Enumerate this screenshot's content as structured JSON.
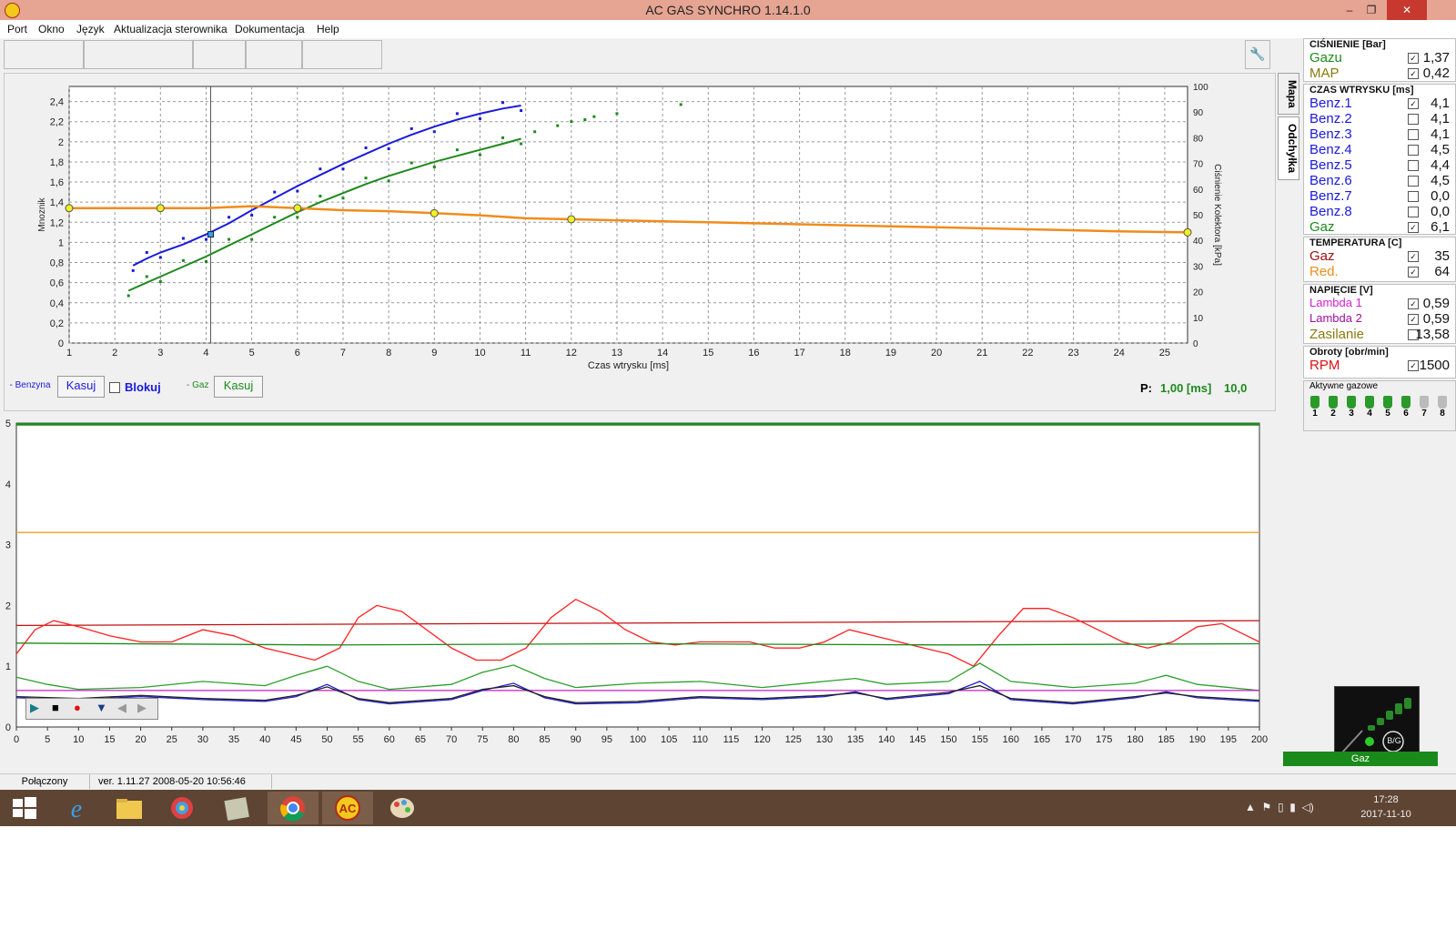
{
  "window": {
    "title": "AC GAS SYNCHRO     1.14.1.0",
    "minimize": "–",
    "restore": "❐",
    "close": "✕"
  },
  "menu": [
    "Port",
    "Okno",
    "Język",
    "Aktualizacja sterownika",
    "Dokumentacja",
    "Help"
  ],
  "side_tabs": {
    "map": "Mapa",
    "deviation": "Odchyłka"
  },
  "map_chart": {
    "y_left_label": "Mnoznik",
    "y_right_label": "Ciśnienie Kolektora [kPa]",
    "x_label": "Czas wtrysku [ms]",
    "y_left_ticks": [
      "0",
      "0,2",
      "0,4",
      "0,6",
      "0,8",
      "1",
      "1,2",
      "1,4",
      "1,6",
      "1,8",
      "2",
      "2,2",
      "2,4"
    ],
    "y_right_ticks": [
      "0",
      "10",
      "20",
      "30",
      "40",
      "50",
      "60",
      "70",
      "80",
      "90",
      "100"
    ],
    "x_ticks": [
      "1",
      "2",
      "3",
      "4",
      "5",
      "6",
      "7",
      "8",
      "9",
      "10",
      "11",
      "12",
      "13",
      "14",
      "15",
      "16",
      "17",
      "18",
      "19",
      "20",
      "21",
      "22",
      "23",
      "24",
      "25"
    ]
  },
  "map_controls": {
    "benzyna_legend": "- Benzyna",
    "kasuj_left": "Kasuj",
    "blokuj": "Blokuj",
    "gaz_legend": "- Gaz",
    "kasuj_right": "Kasuj",
    "p_label": "P:",
    "p_value": "1,00 [ms]",
    "p_value2": "10,0"
  },
  "chart_data": [
    {
      "type": "scatter",
      "title": "",
      "xlabel": "Czas wtrysku [ms]",
      "ylabel": "Mnoznik",
      "xlim": [
        1,
        25.5
      ],
      "ylim": [
        0,
        2.55
      ],
      "series": [
        {
          "name": "Benzyna",
          "color": "#1a1adc",
          "x": [
            2.4,
            2.7,
            3.0,
            3.5,
            4.0,
            4.5,
            5.0,
            5.5,
            6.0,
            6.5,
            7.0,
            7.5,
            8.0,
            8.5,
            9.0,
            9.5,
            10.0,
            10.5,
            10.9
          ],
          "values": [
            0.77,
            0.84,
            0.9,
            0.98,
            1.08,
            1.19,
            1.32,
            1.44,
            1.56,
            1.67,
            1.78,
            1.88,
            1.98,
            2.07,
            2.15,
            2.22,
            2.28,
            2.33,
            2.36
          ]
        },
        {
          "name": "Gaz",
          "color": "#1d8a1d",
          "x": [
            2.3,
            2.7,
            3.0,
            3.5,
            4.0,
            4.5,
            5.0,
            5.5,
            6.0,
            6.5,
            7.0,
            7.5,
            8.0,
            8.5,
            9.0,
            9.5,
            10.0,
            10.5,
            10.9
          ],
          "values": [
            0.52,
            0.6,
            0.66,
            0.76,
            0.86,
            0.97,
            1.08,
            1.19,
            1.3,
            1.4,
            1.49,
            1.58,
            1.66,
            1.73,
            1.8,
            1.86,
            1.92,
            1.98,
            2.03
          ]
        },
        {
          "name": "Ciśnienie",
          "color": "#f08c1c",
          "x": [
            1,
            2,
            3,
            4,
            5,
            6,
            7,
            8,
            9,
            10,
            11,
            12,
            13,
            14,
            15,
            16,
            17,
            18,
            19,
            20,
            21,
            22,
            23,
            24,
            25.5
          ],
          "values": [
            1.34,
            1.34,
            1.34,
            1.34,
            1.36,
            1.34,
            1.32,
            1.31,
            1.29,
            1.27,
            1.24,
            1.23,
            1.22,
            1.21,
            1.2,
            1.19,
            1.18,
            1.17,
            1.16,
            1.15,
            1.14,
            1.13,
            1.12,
            1.11,
            1.1
          ]
        },
        {
          "name": "Gaz points",
          "color": "#1d8a1d",
          "x": [
            11.2,
            11.7,
            12.0,
            12.3,
            12.5,
            13.0,
            14.4
          ],
          "values": [
            2.1,
            2.16,
            2.2,
            2.22,
            2.25,
            2.28,
            2.37
          ]
        }
      ]
    },
    {
      "type": "line",
      "title": "",
      "xlim": [
        0,
        200
      ],
      "ylim": [
        0,
        5
      ],
      "x_ticks": [
        "0",
        "5",
        "10",
        "15",
        "20",
        "25",
        "30",
        "35",
        "40",
        "45",
        "50",
        "55",
        "60",
        "65",
        "70",
        "75",
        "80",
        "85",
        "90",
        "95",
        "100",
        "105",
        "110",
        "115",
        "120",
        "125",
        "130",
        "135",
        "140",
        "145",
        "150",
        "155",
        "160",
        "165",
        "170",
        "175",
        "180",
        "185",
        "190",
        "195",
        "200"
      ],
      "y_ticks": [
        "0",
        "1",
        "2",
        "3",
        "4",
        "5"
      ],
      "series": [
        {
          "name": "green-top",
          "color": "#1d8a1d",
          "x": [
            0,
            200
          ],
          "values": [
            4.98,
            4.98
          ]
        },
        {
          "name": "orange",
          "color": "#f0a020",
          "x": [
            0,
            200
          ],
          "values": [
            3.2,
            3.2
          ]
        },
        {
          "name": "red-mean",
          "color": "#c01010",
          "x": [
            0,
            200
          ],
          "values": [
            1.67,
            1.75
          ]
        },
        {
          "name": "red",
          "color": "#ff2020",
          "x": [
            0,
            3,
            6,
            10,
            15,
            20,
            25,
            30,
            35,
            40,
            44,
            48,
            52,
            55,
            58,
            62,
            66,
            70,
            74,
            78,
            82,
            86,
            90,
            94,
            98,
            102,
            106,
            110,
            114,
            118,
            122,
            126,
            130,
            134,
            138,
            142,
            146,
            150,
            154,
            158,
            162,
            166,
            170,
            174,
            178,
            182,
            186,
            190,
            194,
            198,
            200
          ],
          "values": [
            1.2,
            1.6,
            1.75,
            1.65,
            1.5,
            1.4,
            1.4,
            1.6,
            1.5,
            1.3,
            1.2,
            1.1,
            1.3,
            1.8,
            2.0,
            1.9,
            1.6,
            1.3,
            1.1,
            1.1,
            1.3,
            1.8,
            2.1,
            1.9,
            1.6,
            1.4,
            1.35,
            1.4,
            1.4,
            1.4,
            1.3,
            1.3,
            1.4,
            1.6,
            1.5,
            1.4,
            1.3,
            1.2,
            1.0,
            1.5,
            1.95,
            1.95,
            1.8,
            1.6,
            1.4,
            1.3,
            1.4,
            1.65,
            1.7,
            1.5,
            1.4
          ]
        },
        {
          "name": "green-mean",
          "color": "#1d8a1d",
          "x": [
            0,
            50,
            100,
            150,
            200
          ],
          "values": [
            1.38,
            1.35,
            1.37,
            1.35,
            1.37
          ]
        },
        {
          "name": "green",
          "color": "#2aa02a",
          "x": [
            0,
            5,
            10,
            20,
            30,
            40,
            45,
            50,
            55,
            60,
            70,
            75,
            80,
            85,
            90,
            100,
            110,
            120,
            130,
            135,
            140,
            150,
            155,
            160,
            170,
            180,
            185,
            190,
            200
          ],
          "values": [
            0.82,
            0.7,
            0.62,
            0.65,
            0.75,
            0.68,
            0.85,
            1.0,
            0.75,
            0.62,
            0.7,
            0.9,
            1.02,
            0.8,
            0.65,
            0.72,
            0.75,
            0.65,
            0.75,
            0.8,
            0.7,
            0.75,
            1.05,
            0.75,
            0.65,
            0.72,
            0.85,
            0.7,
            0.6
          ]
        },
        {
          "name": "magenta",
          "color": "#c020c0",
          "x": [
            0,
            200
          ],
          "values": [
            0.6,
            0.6
          ]
        },
        {
          "name": "blue",
          "color": "#2020d0",
          "x": [
            0,
            10,
            20,
            30,
            40,
            45,
            50,
            55,
            60,
            70,
            75,
            80,
            85,
            90,
            100,
            110,
            120,
            130,
            135,
            140,
            150,
            155,
            160,
            170,
            180,
            185,
            190,
            200
          ],
          "values": [
            0.48,
            0.45,
            0.5,
            0.45,
            0.42,
            0.5,
            0.7,
            0.45,
            0.38,
            0.45,
            0.6,
            0.72,
            0.48,
            0.38,
            0.4,
            0.48,
            0.45,
            0.5,
            0.58,
            0.45,
            0.55,
            0.75,
            0.45,
            0.38,
            0.48,
            0.58,
            0.48,
            0.42
          ]
        },
        {
          "name": "black",
          "color": "#222222",
          "x": [
            0,
            10,
            20,
            30,
            40,
            45,
            50,
            55,
            60,
            70,
            75,
            80,
            85,
            90,
            100,
            110,
            120,
            130,
            135,
            140,
            150,
            155,
            160,
            170,
            180,
            185,
            190,
            200
          ],
          "values": [
            0.5,
            0.47,
            0.52,
            0.47,
            0.44,
            0.52,
            0.66,
            0.47,
            0.4,
            0.47,
            0.62,
            0.68,
            0.5,
            0.4,
            0.42,
            0.5,
            0.47,
            0.52,
            0.56,
            0.47,
            0.57,
            0.68,
            0.47,
            0.4,
            0.5,
            0.56,
            0.5,
            0.44
          ]
        }
      ]
    }
  ],
  "playback": [
    "▶",
    "■",
    "●",
    "▼",
    "◀",
    "▶"
  ],
  "right": {
    "pressure_title": "CIŚNIENIE [Bar]",
    "pressure": [
      {
        "label": "Gazu",
        "color": "#1d8a1d",
        "value": "1,37",
        "checked": "✓"
      },
      {
        "label": "MAP",
        "color": "#8a7a10",
        "value": "0,42",
        "checked": "✓"
      }
    ],
    "inj_title": "CZAS WTRYSKU [ms]",
    "injection": [
      {
        "label": "Benz.1",
        "color": "#1a1adc",
        "value": "4,1",
        "checked": "✓"
      },
      {
        "label": "Benz.2",
        "color": "#1a1adc",
        "value": "4,1",
        "checked": ""
      },
      {
        "label": "Benz.3",
        "color": "#1a1adc",
        "value": "4,1",
        "checked": ""
      },
      {
        "label": "Benz.4",
        "color": "#1a1adc",
        "value": "4,5",
        "checked": ""
      },
      {
        "label": "Benz.5",
        "color": "#1a1adc",
        "value": "4,4",
        "checked": ""
      },
      {
        "label": "Benz.6",
        "color": "#1a1adc",
        "value": "4,5",
        "checked": ""
      },
      {
        "label": "Benz.7",
        "color": "#1a1adc",
        "value": "0,0",
        "checked": ""
      },
      {
        "label": "Benz.8",
        "color": "#1a1adc",
        "value": "0,0",
        "checked": ""
      },
      {
        "label": "Gaz",
        "color": "#1d8a1d",
        "value": "6,1",
        "checked": "✓"
      }
    ],
    "temp_title": "TEMPERATURA [C]",
    "temperature": [
      {
        "label": "Gaz",
        "color": "#a01010",
        "value": "35",
        "checked": "✓"
      },
      {
        "label": "Red.",
        "color": "#f08c1c",
        "value": "64",
        "checked": "✓"
      }
    ],
    "volt_title": "NAPIĘCIE [V]",
    "voltage": [
      {
        "label": "Lambda 1",
        "color": "#d020d0",
        "value": "0,59",
        "checked": "✓"
      },
      {
        "label": "Lambda 2",
        "color": "#a010a0",
        "value": "0,59",
        "checked": "✓"
      },
      {
        "label": "Zasilanie",
        "color": "#8a7a10",
        "value": "13,58",
        "checked": ""
      }
    ],
    "rpm_title": "Obroty [obr/min]",
    "rpm": [
      {
        "label": "RPM",
        "color": "#e01010",
        "value": "1500",
        "checked": "✓"
      }
    ],
    "active_title": "Aktywne gazowe",
    "injectors": [
      "1",
      "2",
      "3",
      "4",
      "5",
      "6",
      "7",
      "8"
    ],
    "bg_label": "B/G",
    "mode": "Gaz"
  },
  "status": {
    "connection": "Połączony",
    "version": "ver. 1.11.27   2008-05-20   10:56:46"
  },
  "taskbar": {
    "time": "17:28",
    "date": "2017-11-10"
  }
}
